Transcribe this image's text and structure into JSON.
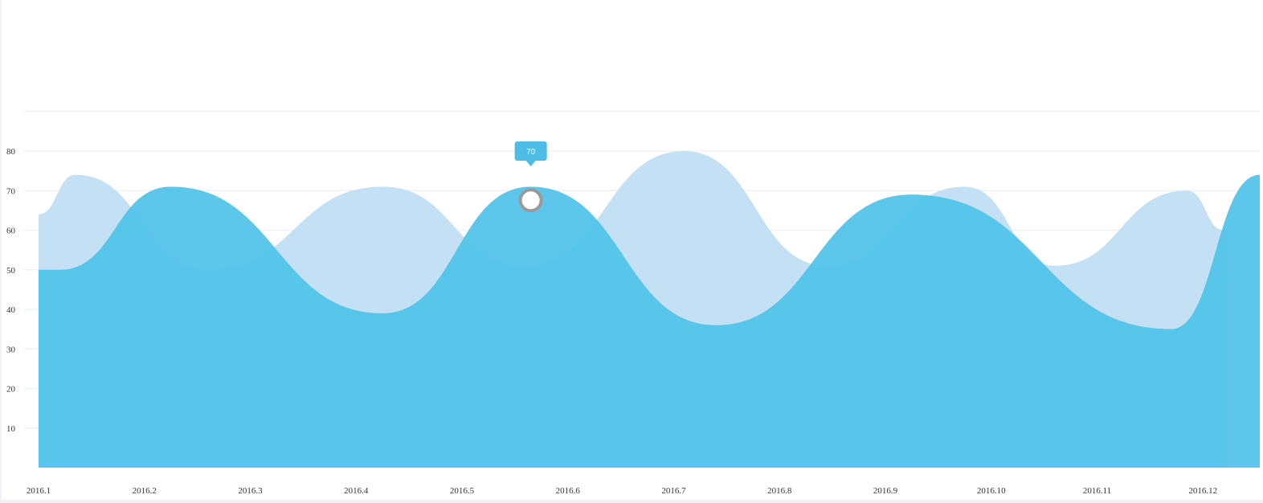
{
  "chart_data": {
    "type": "area",
    "x": [
      "2016.1",
      "2016.2",
      "2016.3",
      "2016.4",
      "2016.5",
      "2016.6",
      "2016.7",
      "2016.8",
      "2016.9",
      "2016.10",
      "2016.11",
      "2016.12"
    ],
    "y_ticks": [
      {
        "value": 10,
        "label": "10"
      },
      {
        "value": 20,
        "label": "20"
      },
      {
        "value": 30,
        "label": "30"
      },
      {
        "value": 40,
        "label": "40"
      },
      {
        "value": 50,
        "label": "50"
      },
      {
        "value": 60,
        "label": "60"
      },
      {
        "value": 70,
        "label": "70"
      },
      {
        "value": 80,
        "label": "80"
      }
    ],
    "ylim": [
      0,
      90
    ],
    "grid": true,
    "series": [
      {
        "color": "#c4e0f4",
        "points": [
          {
            "x": 0.0,
            "y": 64
          },
          {
            "x": 0.35,
            "y": 74
          },
          {
            "x": 1.6,
            "y": 50
          },
          {
            "x": 3.25,
            "y": 71
          },
          {
            "x": 4.6,
            "y": 51
          },
          {
            "x": 6.1,
            "y": 80
          },
          {
            "x": 7.45,
            "y": 51
          },
          {
            "x": 8.75,
            "y": 71
          },
          {
            "x": 9.6,
            "y": 51
          },
          {
            "x": 10.85,
            "y": 70
          },
          {
            "x": 11.2,
            "y": 60
          }
        ]
      },
      {
        "color": "#4ec2e8",
        "points": [
          {
            "x": 0.0,
            "y": 50
          },
          {
            "x": 0.2,
            "y": 50
          },
          {
            "x": 1.25,
            "y": 71
          },
          {
            "x": 3.25,
            "y": 39
          },
          {
            "x": 4.65,
            "y": 71
          },
          {
            "x": 6.4,
            "y": 36
          },
          {
            "x": 8.25,
            "y": 69
          },
          {
            "x": 10.7,
            "y": 35
          },
          {
            "x": 11.8,
            "y": 74
          },
          {
            "x": 12.2,
            "y": 70
          }
        ]
      }
    ],
    "highlight": {
      "x": 4.65,
      "y": 70,
      "label": "70"
    }
  }
}
